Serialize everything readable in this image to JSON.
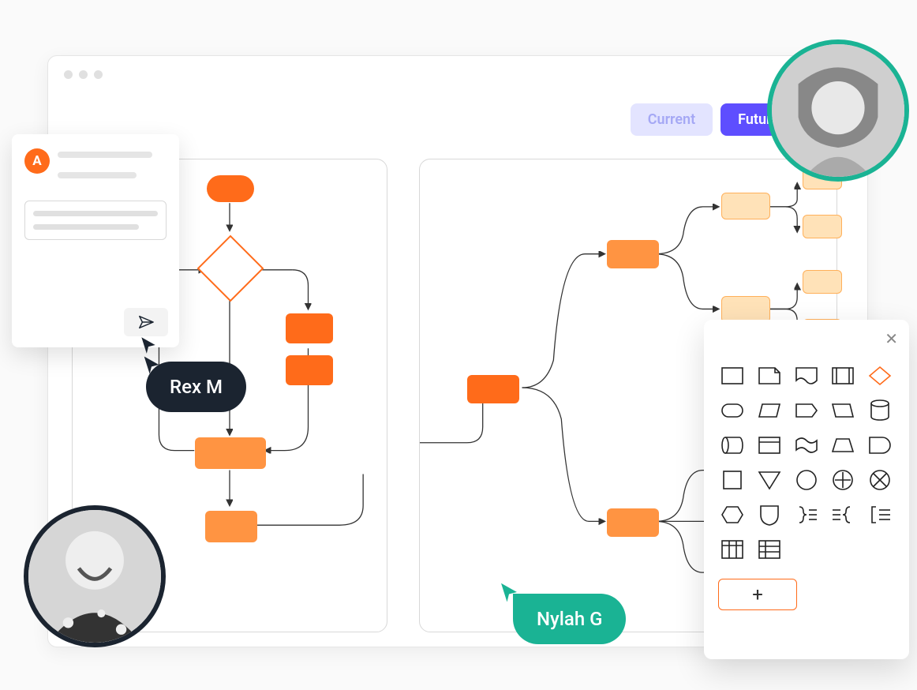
{
  "tabs": {
    "current_label": "Current",
    "future_label": "Future",
    "active": "future"
  },
  "comment_card": {
    "avatar_letter": "A"
  },
  "users": {
    "rex_label": "Rex M",
    "nylah_label": "Nylah G"
  },
  "shape_picker": {
    "close_label": "✕",
    "add_label": "+",
    "shapes": [
      "rectangle",
      "note",
      "document",
      "double-rect",
      "diamond",
      "rounded-rect",
      "parallelogram",
      "pentagon",
      "parallelogram-right",
      "cylinder",
      "cylinder-horiz",
      "card",
      "flag",
      "trapezoid",
      "d-shape",
      "square",
      "triangle-down",
      "circle",
      "circle-plus",
      "circle-x",
      "hexagon",
      "shield",
      "brace-right-lines",
      "lines-brace-left",
      "bracket-lines",
      "table-3col",
      "table-rows"
    ],
    "selected_shape": "diamond"
  },
  "colors": {
    "accent_orange": "#ff6b1a",
    "accent_purple": "#5e4eff",
    "accent_teal": "#1AB394",
    "pill_dark": "#1b2430"
  }
}
